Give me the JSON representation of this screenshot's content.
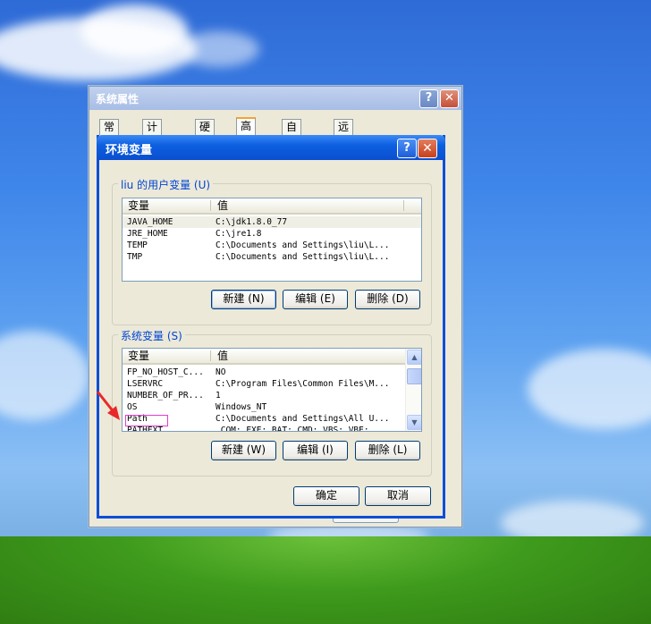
{
  "system_properties": {
    "title": "系统属性",
    "tabs": [
      "常规",
      "计算机名",
      "硬件",
      "高级",
      "自动更新",
      "远程"
    ],
    "active_tab": "高级",
    "help_glyph": "?",
    "close_glyph": "✕"
  },
  "env_dialog": {
    "title": "环境变量",
    "help_glyph": "?",
    "close_glyph": "✕",
    "user_group": {
      "legend": "liu 的用户变量 (U)",
      "columns": [
        "变量",
        "值"
      ],
      "rows": [
        {
          "name": "JAVA_HOME",
          "value": "C:\\jdk1.8.0_77"
        },
        {
          "name": "JRE_HOME",
          "value": "C:\\jre1.8"
        },
        {
          "name": "TEMP",
          "value": "C:\\Documents and Settings\\liu\\L..."
        },
        {
          "name": "TMP",
          "value": "C:\\Documents and Settings\\liu\\L..."
        }
      ],
      "buttons": {
        "new": "新建 (N)",
        "edit": "编辑 (E)",
        "delete": "删除 (D)"
      }
    },
    "system_group": {
      "legend": "系统变量 (S)",
      "columns": [
        "变量",
        "值"
      ],
      "rows": [
        {
          "name": "FP_NO_HOST_C...",
          "value": "NO"
        },
        {
          "name": "LSERVRC",
          "value": "C:\\Program Files\\Common Files\\M..."
        },
        {
          "name": "NUMBER_OF_PR...",
          "value": "1"
        },
        {
          "name": "OS",
          "value": "Windows_NT"
        },
        {
          "name": "Path",
          "value": "C:\\Documents and Settings\\All U..."
        },
        {
          "name": "PATHEXT",
          "value": ".COM;.EXE;.BAT;.CMD;.VBS;.VBE;..."
        }
      ],
      "buttons": {
        "new": "新建 (W)",
        "edit": "编辑 (I)",
        "delete": "删除 (L)"
      },
      "scroll_up": "▲",
      "scroll_down": "▼"
    },
    "ok": "确定",
    "cancel": "取消"
  },
  "colors": {
    "annotation_arrow": "#e8282b",
    "annotation_box": "#e040d0"
  }
}
